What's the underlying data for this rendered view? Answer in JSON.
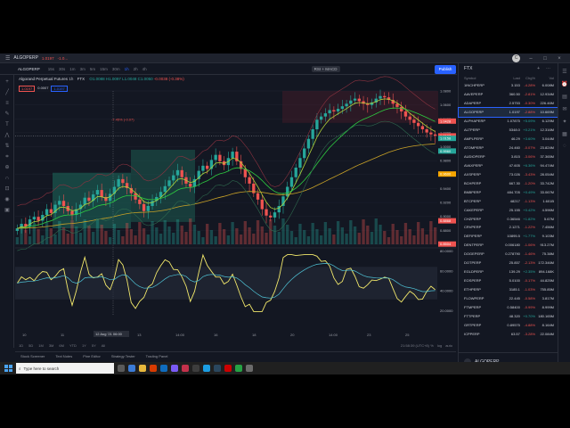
{
  "app": {
    "symbol_tab": "ALGOPERP",
    "top_price": "1.0197",
    "top_change": "-1.0...",
    "avatar_letter": "C"
  },
  "toolbar": {
    "symbol": "ALGOPERP",
    "intervals": [
      "15s",
      "30s",
      "1m",
      "3m",
      "5m",
      "15m",
      "30m",
      "1h",
      "2h",
      "4h"
    ],
    "indicator_pill": "RSI + MACD",
    "publish_label": "Publish"
  },
  "legend": {
    "name": "Algorand Perpetual Futures",
    "interval": "1h",
    "exchange": "FTX",
    "ohlc": "O1.0088 H1.0097 L1.0048 C1.0050",
    "change": "-0.0038 (-0.38%)",
    "sell_price": "1.0197",
    "spread": "0.0007",
    "buy_price": "1.0197"
  },
  "chart_data": {
    "type": "candlestick",
    "price_axis": [
      "1.0800",
      "1.0600",
      "1.0400",
      "1.0200",
      "1.0000",
      "0.9800",
      "0.9600",
      "0.9400",
      "0.9200",
      "0.9000",
      "0.8800",
      "0.8600"
    ],
    "price_tags": [
      "1.0428",
      "1.0197",
      "1.0158",
      "0.9960",
      "0.9600",
      "0.8868",
      "0.8504"
    ],
    "osc_axis": [
      "80.0000",
      "60.0000",
      "40.0000",
      "20.0000"
    ],
    "x_labels": [
      "10",
      "11",
      "12 Aug '21",
      "13",
      "14:00",
      "16",
      "18",
      "20",
      "14:00",
      "23",
      "25"
    ],
    "cursor_label": "12 Aug '21  06:00",
    "annotation": "-7.45% (-0.07)",
    "annotation_left": "",
    "closes": [
      0.875,
      0.882,
      0.878,
      0.889,
      0.893,
      0.887,
      0.896,
      0.905,
      0.899,
      0.912,
      0.918,
      0.91,
      0.902,
      0.896,
      0.905,
      0.912,
      0.923,
      0.918,
      0.928,
      0.935,
      0.924,
      0.918,
      0.929,
      0.94,
      0.952,
      0.946,
      0.938,
      0.93,
      0.92,
      0.913,
      0.902,
      0.91,
      0.918,
      0.924,
      0.932,
      0.941,
      0.95,
      0.958,
      0.966,
      0.955,
      0.945,
      0.94,
      0.952,
      0.965,
      0.973,
      0.968,
      0.982,
      0.99,
      0.98,
      0.974,
      0.985,
      0.995,
      0.98,
      0.968,
      0.955,
      0.945,
      0.93,
      0.92,
      0.905,
      0.895,
      0.892,
      0.9,
      0.91,
      0.925,
      0.94,
      0.955,
      0.97,
      0.985,
      1.0,
      1.015,
      1.03,
      1.045,
      1.05,
      1.055,
      1.06,
      1.058,
      1.062,
      1.066,
      1.07,
      1.075,
      1.078,
      1.074,
      1.07,
      1.068,
      1.072,
      1.078,
      1.082,
      1.08,
      1.076,
      1.07,
      1.065,
      1.058,
      1.05,
      1.045,
      1.04,
      1.035,
      1.03,
      1.025,
      1.022,
      1.02
    ]
  },
  "bottom_nav": {
    "ranges": [
      "1D",
      "5D",
      "1M",
      "3M",
      "6M",
      "YTD",
      "1Y",
      "5Y",
      "All"
    ],
    "clock": "21:58:39 (UTC+8)",
    "right_opts": [
      "%",
      "log",
      "auto"
    ]
  },
  "panels": [
    "Stock Screener",
    "Text Notes",
    "Pine Editor",
    "Strategy Tester",
    "Trading Panel"
  ],
  "watchlist": {
    "title": "FTX",
    "columns": [
      "Symbol",
      "Last",
      "Chg%",
      "Vol"
    ],
    "rows": [
      {
        "symbol": "1INCHPERP",
        "last": "3.153",
        "chg": "-4.28%",
        "vol": "6.008M",
        "up": false
      },
      {
        "symbol": "AAVEPERP",
        "last": "360.50",
        "chg": "-2.81%",
        "vol": "12.934M",
        "up": false
      },
      {
        "symbol": "ADAPERP",
        "last": "2.5753",
        "chg": "-0.30%",
        "vol": "226.46M",
        "up": false
      },
      {
        "symbol": "ALGOPERP",
        "last": "1.0197",
        "chg": "-2.88%",
        "vol": "10.669M",
        "up": false
      },
      {
        "symbol": "ALPHAPERP",
        "last": "1.07875",
        "chg": "+5.09%",
        "vol": "6.129M",
        "up": true
      },
      {
        "symbol": "ALTPERP",
        "last": "5348.0",
        "chg": "+0.21%",
        "vol": "12.316M",
        "up": true
      },
      {
        "symbol": "AMPLPERP",
        "last": "46.29",
        "chg": "+3.60%",
        "vol": "3.044M",
        "up": true
      },
      {
        "symbol": "ATOMPERP",
        "last": "24.460",
        "chg": "-0.07%",
        "vol": "23.824M",
        "up": false
      },
      {
        "symbol": "AUDIOPERP",
        "last": "3.815",
        "chg": "-3.06%",
        "vol": "37.365M",
        "up": false
      },
      {
        "symbol": "AVAXPERP",
        "last": "47.605",
        "chg": "+6.36%",
        "vol": "94.474M",
        "up": true
      },
      {
        "symbol": "AXSPERP",
        "last": "73.026",
        "chg": "-3.43%",
        "vol": "28.054M",
        "up": false
      },
      {
        "symbol": "BCHPERP",
        "last": "667.30",
        "chg": "-1.20%",
        "vol": "33.742M",
        "up": false
      },
      {
        "symbol": "BNBPERP",
        "last": "484.705",
        "chg": "+0.49%",
        "vol": "33.067M",
        "up": true
      },
      {
        "symbol": "BTCPERP",
        "last": "48217",
        "chg": "-1.13%",
        "vol": "1.601B",
        "up": false
      },
      {
        "symbol": "CAKEPERP",
        "last": "25.155",
        "chg": "+0.42%",
        "vol": "4.596M",
        "up": true
      },
      {
        "symbol": "CHZPERP",
        "last": "0.36546",
        "chg": "+1.82%",
        "vol": "5.67M",
        "up": true
      },
      {
        "symbol": "CRVPERP",
        "last": "2.1271",
        "chg": "-1.22%",
        "vol": "7.456M",
        "up": false
      },
      {
        "symbol": "DEFIPERP",
        "last": "10895.5",
        "chg": "+1.77%",
        "vol": "9.103M",
        "up": true
      },
      {
        "symbol": "DENTPERP",
        "last": "0.006180",
        "chg": "-1.06%",
        "vol": "913.27M",
        "up": false
      },
      {
        "symbol": "DOGEPERP",
        "last": "0.278790",
        "chg": "-1.46%",
        "vol": "75.38M",
        "up": false
      },
      {
        "symbol": "DOTPERP",
        "last": "25.857",
        "chg": "-2.13%",
        "vol": "172.346M",
        "up": false
      },
      {
        "symbol": "EGLDPERP",
        "last": "139.29",
        "chg": "+2.35%",
        "vol": "894.168K",
        "up": true
      },
      {
        "symbol": "EOSPERP",
        "last": "5.0100",
        "chg": "-0.17%",
        "vol": "44.825M",
        "up": false
      },
      {
        "symbol": "ETHPERP",
        "last": "3185.1",
        "chg": "-1.03%",
        "vol": "755.85M",
        "up": false
      },
      {
        "symbol": "FLOWPERP",
        "last": "22.445",
        "chg": "-0.58%",
        "vol": "3.817M",
        "up": false
      },
      {
        "symbol": "FTMPERP",
        "last": "0.58400",
        "chg": "-0.99%",
        "vol": "8.999M",
        "up": false
      },
      {
        "symbol": "FTTPERP",
        "last": "48.320",
        "chg": "+0.70%",
        "vol": "180.165M",
        "up": true
      },
      {
        "symbol": "GRTPERP",
        "last": "0.89575",
        "chg": "-4.88%",
        "vol": "8.164M",
        "up": false
      },
      {
        "symbol": "ICPPERP",
        "last": "63.57",
        "chg": "-3.28%",
        "vol": "22.084M",
        "up": false
      }
    ],
    "footer_symbol": "ALGOPERP"
  },
  "taskbar": {
    "search_placeholder": "Type here to search"
  },
  "colors": {
    "up": "#26a69a",
    "down": "#ef5350",
    "accent": "#2962ff",
    "ema_fast": "#b0d33a",
    "ema_mid": "#2ecc40",
    "ema_slow": "#c9a227",
    "rsi": "#f2e86b"
  }
}
